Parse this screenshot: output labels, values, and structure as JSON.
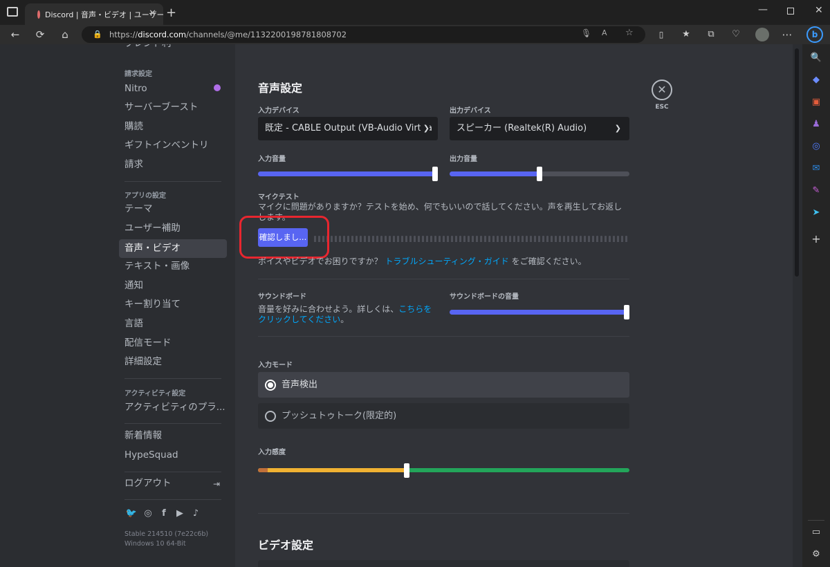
{
  "browser": {
    "tab_title": "Discord | 音声・ビデオ | ユーザー",
    "url_prefix": "https://",
    "url_domain": "discord.com",
    "url_path": "/channels/@me/1132200198781808702",
    "window_controls": [
      "minimize-icon",
      "maximize-icon",
      "close-icon"
    ]
  },
  "sidebar": {
    "cutoff_item": "ブレンド利",
    "billing_header": "請求設定",
    "billing_items": [
      "Nitro",
      "サーバーブースト",
      "購読",
      "ギフトインベントリ",
      "請求"
    ],
    "app_header": "アプリの設定",
    "app_items": [
      "テーマ",
      "ユーザー補助",
      "音声・ビデオ",
      "テキスト・画像",
      "通知",
      "キー割り当て",
      "言語",
      "配信モード",
      "詳細設定"
    ],
    "selected_item": "音声・ビデオ",
    "activity_header": "アクティビティ設定",
    "activity_items": [
      "アクティビティのプラ..."
    ],
    "misc_items": [
      "新着情報",
      "HypeSquad"
    ],
    "logout": "ログアウト",
    "version_line1": "Stable 214510 (7e22c6b)",
    "version_line2": "Windows 10 64-Bit"
  },
  "voice": {
    "title": "音声設定",
    "input_device_label": "入力デバイス",
    "input_device_value": "既定 - CABLE Output (VB-Audio Virtua",
    "output_device_label": "出力デバイス",
    "output_device_value": "スピーカー (Realtek(R) Audio)",
    "input_volume_label": "入力音量",
    "input_volume_value": 1.0,
    "output_volume_label": "出力音量",
    "output_volume_value": 0.5,
    "mic_test_label": "マイクテスト",
    "mic_test_desc": "マイクに問題がありますか？テストを始め、何でもいいので話してください。声を再生してお返しします。",
    "mic_test_button": "確認しまし...",
    "help_text_prefix": "ボイスやビデオでお困りですか？",
    "help_link": "トラブルシューティング・ガイド",
    "help_text_suffix": "をご確認ください。",
    "soundboard_label": "サウンドボード",
    "soundboard_desc_prefix": "音量を好みに合わせよう。詳しくは、",
    "soundboard_link": "こちらをクリックしてください",
    "soundboard_desc_suffix": "。",
    "soundboard_volume_label": "サウンドボードの音量",
    "soundboard_volume_value": 1.0,
    "input_mode_label": "入力モード",
    "input_mode_options": [
      "音声検出",
      "プッシュトゥトーク(限定的)"
    ],
    "input_mode_selected": "音声検出",
    "sensitivity_label": "入力感度",
    "sensitivity_value": 0.4
  },
  "video": {
    "title": "ビデオ設定"
  },
  "esc": "ESC",
  "colors": {
    "accent": "#5865f2",
    "link": "#00a8fc",
    "highlight_ring": "#e8262f",
    "sens_yellow": "#f0b232",
    "sens_green": "#23a55a"
  }
}
